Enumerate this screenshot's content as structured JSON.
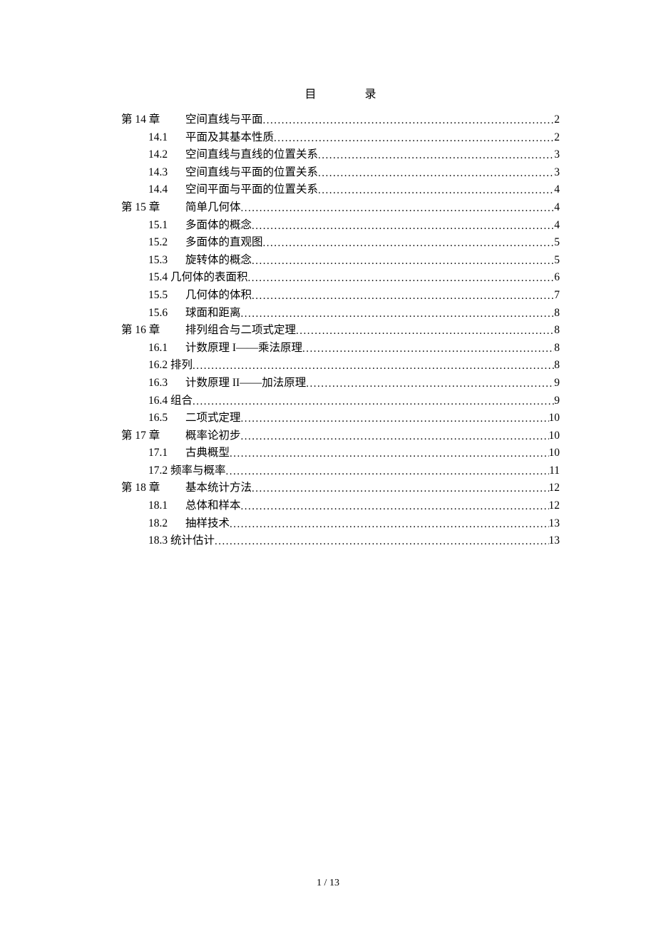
{
  "heading": {
    "char1": "目",
    "char2": "录"
  },
  "entries": [
    {
      "level": "level1",
      "label": "第 14 章",
      "title": "空间直线与平面",
      "page": "2"
    },
    {
      "level": "level2",
      "label": "14.1",
      "title": "平面及其基本性质",
      "page": "2"
    },
    {
      "level": "level2",
      "label": "14.2",
      "title": "空间直线与直线的位置关系",
      "page": "3"
    },
    {
      "level": "level2",
      "label": "14.3",
      "title": "空间直线与平面的位置关系",
      "page": "3"
    },
    {
      "level": "level2",
      "label": "14.4",
      "title": "空间平面与平面的位置关系",
      "page": "4"
    },
    {
      "level": "level1",
      "label": "第 15 章",
      "title": "简单几何体",
      "page": "4"
    },
    {
      "level": "level2",
      "label": "15.1",
      "title": "多面体的概念",
      "page": "4"
    },
    {
      "level": "level2",
      "label": "15.2",
      "title": "多面体的直观图",
      "page": "5"
    },
    {
      "level": "level2",
      "label": "15.3",
      "title": "旋转体的概念",
      "page": "5"
    },
    {
      "level": "level2b",
      "label": "15.4 几何体的表面积",
      "title": "",
      "page": "6"
    },
    {
      "level": "level2",
      "label": "15.5",
      "title": "几何体的体积",
      "page": "7"
    },
    {
      "level": "level2",
      "label": "15.6",
      "title": "球面和距离",
      "page": "8"
    },
    {
      "level": "level1",
      "label": "第 16 章",
      "title": "排列组合与二项式定理",
      "page": "8"
    },
    {
      "level": "level2",
      "label": "16.1",
      "title": "计数原理 I——乘法原理 ",
      "page": "8"
    },
    {
      "level": "level2b",
      "label": "16.2 排列",
      "title": "",
      "page": "8"
    },
    {
      "level": "level2",
      "label": "16.3",
      "title": "计数原理 II——加法原理 ",
      "page": "9"
    },
    {
      "level": "level2b",
      "label": "16.4 组合",
      "title": "",
      "page": "9"
    },
    {
      "level": "level2",
      "label": "16.5",
      "title": "二项式定理",
      "page": "10"
    },
    {
      "level": "level1",
      "label": "第 17 章",
      "title": "概率论初步",
      "page": "10"
    },
    {
      "level": "level2",
      "label": "17.1",
      "title": "古典概型",
      "page": "10"
    },
    {
      "level": "level2b",
      "label": "17.2 频率与概率 ",
      "title": "",
      "page": "11"
    },
    {
      "level": "level1",
      "label": "第 18 章",
      "title": "基本统计方法",
      "page": "12"
    },
    {
      "level": "level2",
      "label": "18.1",
      "title": "总体和样本",
      "page": "12"
    },
    {
      "level": "level2",
      "label": "18.2",
      "title": "抽样技术",
      "page": "13"
    },
    {
      "level": "level2b",
      "label": "18.3 统计估计 ",
      "title": "",
      "page": "13"
    }
  ],
  "footer": {
    "current": "1",
    "sep": " / ",
    "total": "13"
  }
}
